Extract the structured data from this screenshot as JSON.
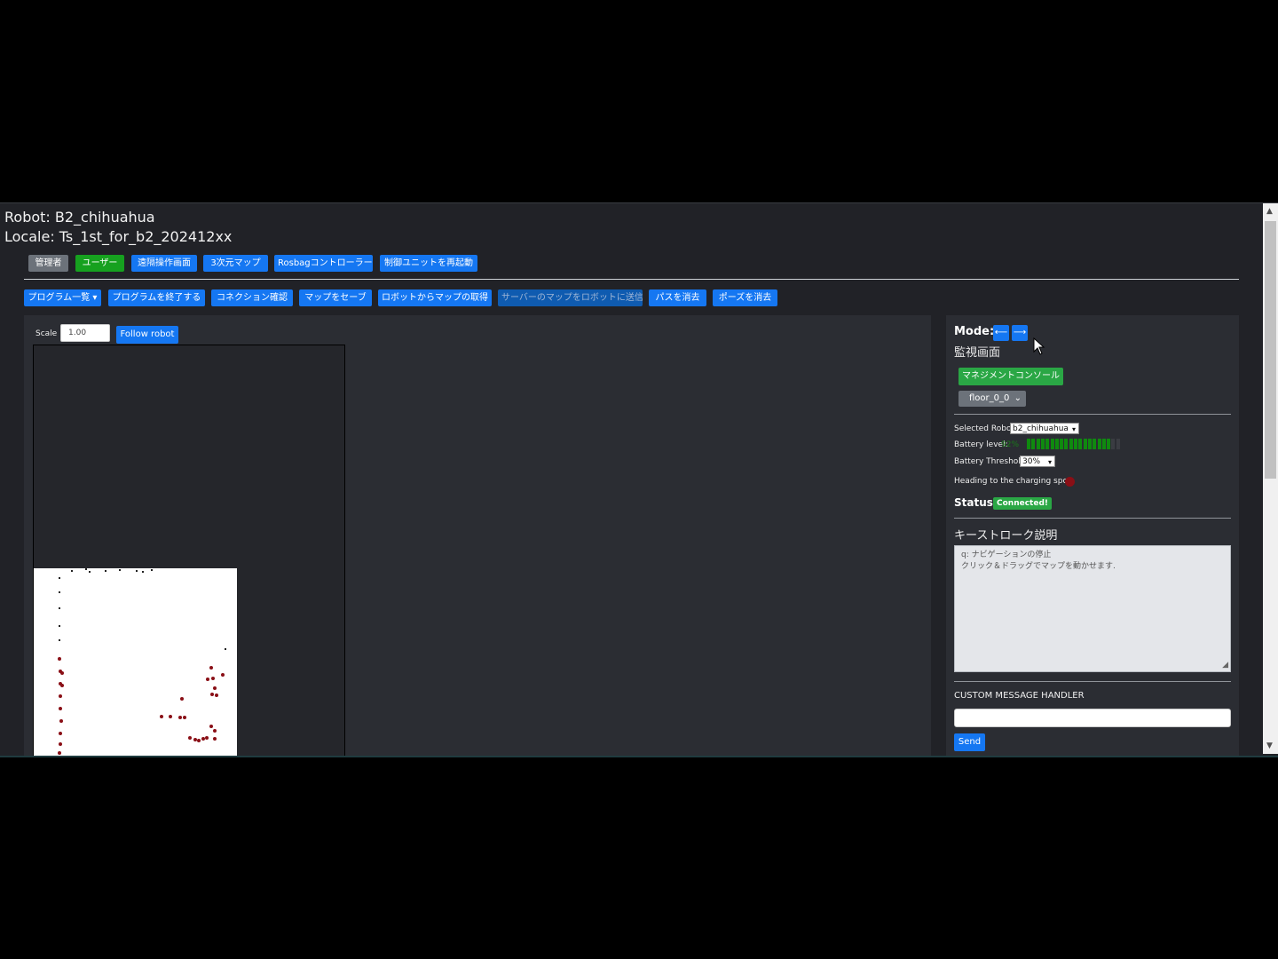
{
  "header": {
    "robot": "Robot: B2_chihuahua",
    "locale": "Locale: Ts_1st_for_b2_202412xx"
  },
  "nav_buttons": [
    "管理者",
    "ユーザー",
    "遠隔操作画面",
    "3次元マップ",
    "Rosbagコントローラー",
    "制御ユニットを再起動"
  ],
  "action_buttons": [
    "プログラム一覧 ▾",
    "プログラムを終了する",
    "コネクション確認",
    "マップをセーブ",
    "ロボットからマップの取得",
    "サーバーのマップをロボットに送信",
    "パスを消去",
    "ポーズを消去"
  ],
  "map_view": {
    "scale_label": "Scale",
    "scale_value": "1.00",
    "follow_label": "Follow robot"
  },
  "side_panel": {
    "mode_label": "Mode:",
    "mode_left": "⟵",
    "mode_right": "⟶",
    "mode_name": "監視画面",
    "management_button": "マネジメントコンソール",
    "floor_select": "floor_0_0",
    "selected_robot_label": "Selected Robot",
    "selected_robot_value": "b2_chihuahua",
    "battery_label": "Battery level:",
    "battery_text": "92%",
    "battery_fraction": 0.92,
    "threshold_label": "Battery Threshold:",
    "threshold_value": "30%",
    "charging_label": "Heading to the charging spot:",
    "status_label": "Status:",
    "status_value": "Connected!",
    "keystroke_title": "キーストローク説明",
    "keystroke_line1": "q: ナビゲーションの停止",
    "keystroke_line2": "クリック＆ドラッグでマップを動かせます.",
    "custom_handler_label": "CUSTOM MESSAGE HANDLER",
    "custom_input_value": "",
    "send_label": "Send"
  },
  "colors": {
    "primary": "#1577f2",
    "success": "#2aa745",
    "battery": "#0f8a0f",
    "charging_indicator": "#8a0f16"
  }
}
